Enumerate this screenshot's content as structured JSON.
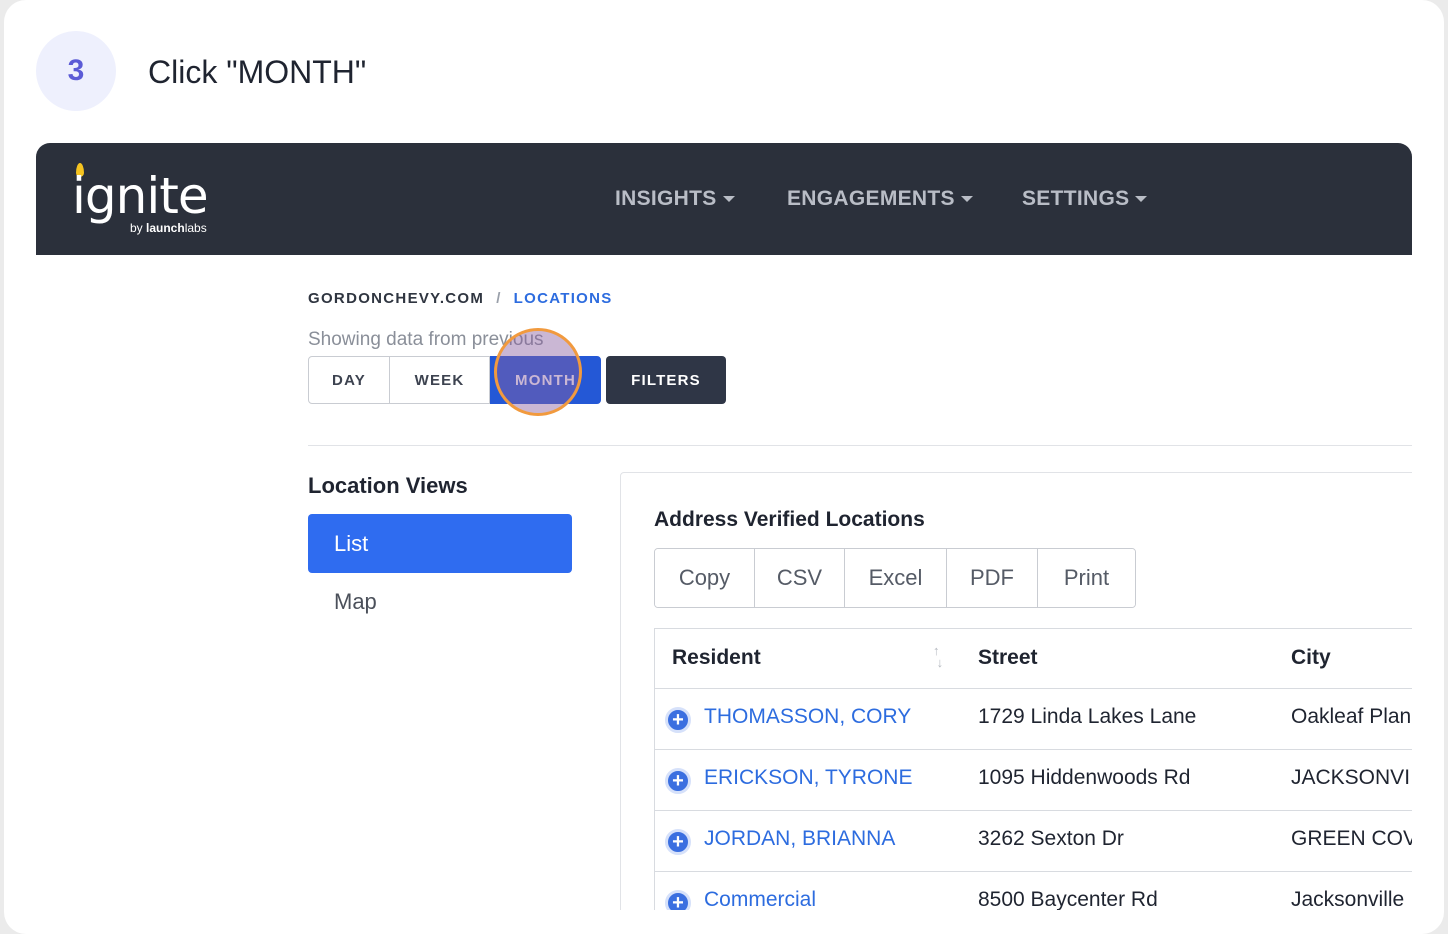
{
  "step": {
    "number": "3",
    "title": "Click \"MONTH\""
  },
  "navbar": {
    "logo": {
      "word": "ignite",
      "by": "by ",
      "brand_bold": "launch",
      "brand_rest": "labs"
    },
    "items": [
      {
        "label": "INSIGHTS"
      },
      {
        "label": "ENGAGEMENTS"
      },
      {
        "label": "SETTINGS"
      }
    ]
  },
  "breadcrumb": {
    "root": "GORDONCHEVY.COM",
    "separator": "/",
    "current": "LOCATIONS"
  },
  "period": {
    "showing_text": "Showing data from previous",
    "options": [
      {
        "label": "DAY"
      },
      {
        "label": "WEEK"
      },
      {
        "label": "MONTH",
        "selected": true
      }
    ],
    "filters_label": "FILTERS"
  },
  "sidebar": {
    "title": "Location Views",
    "items": [
      {
        "label": "List",
        "active": true
      },
      {
        "label": "Map",
        "active": false
      }
    ]
  },
  "panel": {
    "title": "Address Verified Locations",
    "exports": [
      "Copy",
      "CSV",
      "Excel",
      "PDF",
      "Print"
    ],
    "table": {
      "columns": [
        "Resident",
        "Street",
        "City"
      ],
      "rows": [
        {
          "resident": "THOMASSON, CORY",
          "street": "1729 Linda Lakes Lane",
          "city": "Oakleaf Plan"
        },
        {
          "resident": "ERICKSON, TYRONE",
          "street": "1095 Hiddenwoods Rd",
          "city": "JACKSONVI"
        },
        {
          "resident": "JORDAN, BRIANNA",
          "street": "3262 Sexton Dr",
          "city": "GREEN COV"
        },
        {
          "resident": "Commercial",
          "street": "8500 Baycenter Rd",
          "city": "Jacksonville"
        }
      ]
    }
  },
  "colors": {
    "accent": "#2458d6",
    "navbar": "#2b303b",
    "link": "#2d6cdf",
    "highlight_ring": "#f19a3e"
  }
}
